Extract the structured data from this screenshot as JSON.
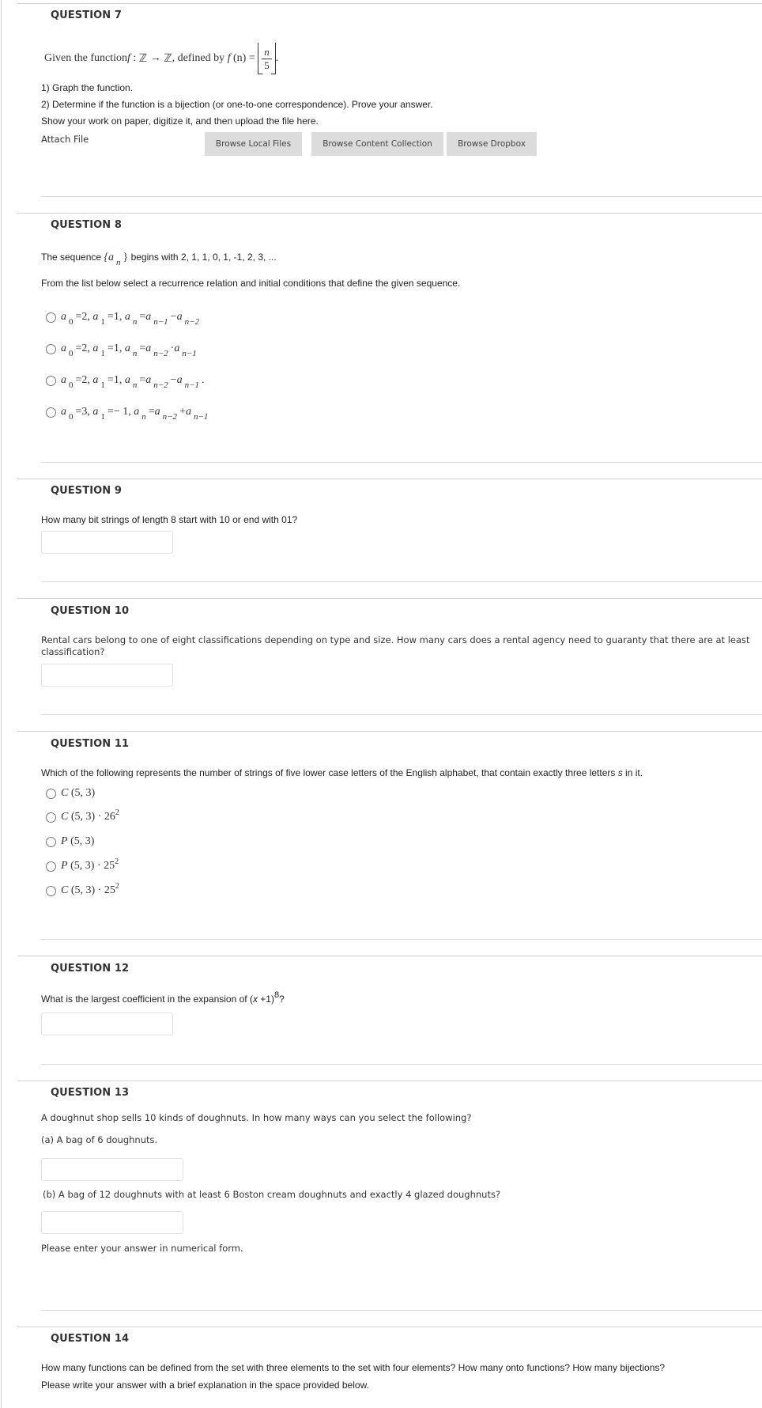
{
  "questions": {
    "q7": {
      "title": "QUESTION 7",
      "intro_prefix": "Given the function ",
      "func_sig": "f",
      "func_colon": " : ",
      "domain": "ℤ",
      "arrow": " → ",
      "codomain": "ℤ",
      "defined_by": ", defined by ",
      "func_lhs": "f",
      "func_arg": " (n) = ",
      "frac_num": "n",
      "frac_den": "5",
      "end_period": ".",
      "line1": "1) Graph the function.",
      "line2": "2) Determine if the function is a bijection (or one-to-one correspondence). Prove your answer.",
      "line3": "Show your work on paper, digitize it, and then upload the file here.",
      "attach_label": "Attach File",
      "buttons": [
        "Browse Local Files",
        "Browse Content Collection",
        "Browse Dropbox"
      ]
    },
    "q8": {
      "title": "QUESTION 8",
      "seq_prefix": "The sequence ",
      "seq_set_open": "{a",
      "seq_sub": "n",
      "seq_set_close": "}",
      "seq_suffix": " begins with 2, 1, 1, 0, 1, -1, 2, 3, ...",
      "instruction": "From the list below select a recurrence relation and initial conditions that define the given sequence.",
      "options": [
        {
          "a0": "2",
          "a1": "1",
          "t1": "n−1",
          "op": "−",
          "t2": "n−2",
          "end": "",
          "selected": false
        },
        {
          "a0": "2",
          "a1": "1",
          "t1": "n−2",
          "op": "·",
          "t2": "n−1",
          "end": "",
          "selected": false
        },
        {
          "a0": "2",
          "a1": "1",
          "t1": "n−2",
          "op": "−",
          "t2": "n−1",
          "end": ".",
          "selected": false
        },
        {
          "a0": "3",
          "a1": "− 1",
          "t1": "n−2",
          "op": "+",
          "t2": "n−1",
          "end": "",
          "selected": false
        }
      ]
    },
    "q9": {
      "title": "QUESTION 9",
      "text": "How many bit strings of length 8 start with 10 or end with 01?",
      "answer": ""
    },
    "q10": {
      "title": "QUESTION 10",
      "text_line1": "Rental cars belong to one of eight classifications depending on type and size. How many cars does a rental agency need to guaranty that there are at least",
      "text_line2": "classification?",
      "answer": ""
    },
    "q11": {
      "title": "QUESTION 11",
      "text_prefix": "Which of the following represents the number of strings of five lower case letters of the English alphabet, that contain exactly three letters ",
      "text_var": "s",
      "text_suffix": " in it.",
      "options": [
        {
          "fn": "C",
          "args": " (5, 3)",
          "mult": "",
          "base": "",
          "exp": "",
          "selected": false
        },
        {
          "fn": "C",
          "args": " (5, 3)",
          "mult": " · ",
          "base": "26",
          "exp": "2",
          "selected": false
        },
        {
          "fn": "P",
          "args": " (5, 3)",
          "mult": "",
          "base": "",
          "exp": "",
          "selected": false
        },
        {
          "fn": "P",
          "args": " (5, 3)",
          "mult": " · ",
          "base": "25",
          "exp": "2",
          "selected": false
        },
        {
          "fn": "C",
          "args": " (5, 3)",
          "mult": " · ",
          "base": "25",
          "exp": "2",
          "selected": false
        }
      ]
    },
    "q12": {
      "title": "QUESTION 12",
      "text_prefix": "What is the largest coefficient in the expansion of (",
      "text_var": "x",
      "text_mid": " +1)",
      "text_exp": "8",
      "text_suffix": "?",
      "answer": ""
    },
    "q13": {
      "title": "QUESTION 13",
      "text": "A doughnut shop sells 10 kinds of doughnuts. In how many ways can you select the following?",
      "part_a": "(a) A bag of 6 doughnuts.",
      "part_b": "(b)  A bag of 12 doughnuts with at least 6 Boston cream doughnuts and exactly 4 glazed doughnuts?",
      "note": "Please enter your answer in numerical form.",
      "answer_a": "",
      "answer_b": ""
    },
    "q14": {
      "title": "QUESTION 14",
      "text_line1": "How many functions can be defined from the set with three elements to the set with four elements? How many onto functions? How many bijections?",
      "text_line2": "Please write your answer with a brief explanation in the space provided below."
    }
  }
}
